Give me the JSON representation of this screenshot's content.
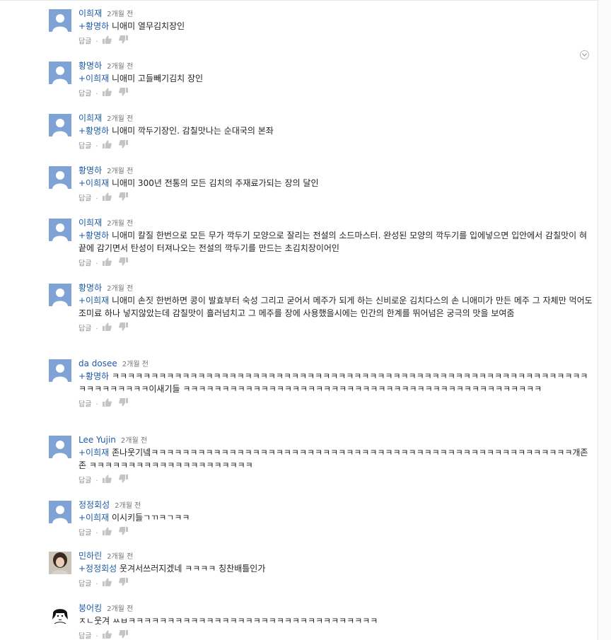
{
  "ui": {
    "reply_label": "답글",
    "separator": "·",
    "accent_link": "#1f5ba8",
    "menu_icon": "chevron-down-circle-icon"
  },
  "comments": [
    {
      "author": "이희재",
      "time": "2개월 전",
      "mention": "+황명하",
      "text": " 니애미 열무김치장인",
      "avatar": "default"
    },
    {
      "author": "황명하",
      "time": "2개월 전",
      "mention": "+이희재",
      "text": " 니애미 고들빼기김치 장인",
      "avatar": "default"
    },
    {
      "author": "이희재",
      "time": "2개월 전",
      "mention": "+황명하",
      "text": " 니애미 깍두기장인. 감칠맛나는 순대국의 본좌",
      "avatar": "default"
    },
    {
      "author": "황명하",
      "time": "2개월 전",
      "mention": "+이희재",
      "text": " 니애미 300년 전통의 모든 김치의 주재료가되는 장의 달인",
      "avatar": "default"
    },
    {
      "author": "이희재",
      "time": "2개월 전",
      "mention": "+황명하",
      "text": " 니애미 칼질 한번으로 모든 무가 깍두기 모양으로 잘리는 전설의 소드마스터. 완성된 모양의 깍두기를 입에넣으면 입안에서 감칠맛이 혀끝에 감기면서 탄성이 터져나오는 전설의 깍두기를 만드는 초김치장이어인",
      "avatar": "default"
    },
    {
      "author": "황명하",
      "time": "2개월 전",
      "mention": "+이희재",
      "text": " 니애미 손짓 한번하면 콩이 발효부터 숙성 그리고 굳어서 메주가 되게 하는 신비로운 김치다스의 손 니애미가 만든 메주 그 자체만 먹어도 조미료 하나 넣지않았는데 감칠맛이 흘러넘치고 그 메주를 장에 사용했을시에는 인간의 한계를 뛰어넘은 궁극의 맛을 보여줌",
      "avatar": "default"
    },
    {
      "author": "da dosee",
      "time": "2개월 전",
      "mention": "+황명하",
      "text": " ㅋㅋㅋㅋㅋㅋㅋㅋㅋㅋㅋㅋㅋㅋㅋㅋㅋㅋㅋㅋㅋㅋㅋㅋㅋㅋㅋㅋㅋㅋㅋㅋㅋㅋㅋㅋㅋㅋㅋㅋㅋㅋㅋㅋㅋㅋㅋㅋㅋㅋㅋㅋㅋㅋㅋㅋㅋㅋㅋㅋㅋㅋㅋㅋㅋㅋㅋㅋㅋㅋ이새기들 ㅋㅋㅋㅋㅋㅋㅋㅋㅋㅋㅋㅋㅋㅋㅋㅋㅋㅋㅋㅋㅋㅋㅋㅋㅋㅋㅋㅋㅋㅋㅋㅋㅋㅋㅋㅋㅋㅋㅋㅋㅋㅋㅋㅋㅋㅋ",
      "avatar": "default"
    },
    {
      "author": "Lee Yujin",
      "time": "2개월 전",
      "mention": "+이희재",
      "text": " 존나웃기넼ㅋㅋㅋㅋㅋㅋㅋㅋㅋㅋㅋㅋㅋㅋㅋㅋㅋㅋㅋㅋㅋㅋㅋㅋㅋㅋㅋㅋㅋㅋㅋㅋㅋㅋㅋㅋㅋㅋㅋㅋㅋㅋㅋㅋㅋㅋㅋㅋㅋㅋㅋㅋㅋㅋ개존존 ㅋㅋㅋㅋㅋㅋㅋㅋㅋㅋㅋㅋㅋㅋㅋㅋㅋㅋㅋㅋㅋ",
      "avatar": "default"
    },
    {
      "author": "정정회성",
      "time": "2개월 전",
      "mention": "+이희재",
      "text": " 이시키들ㄱㄲㅋㄱㅋㅋ",
      "avatar": "default"
    },
    {
      "author": "민하린",
      "time": "2개월 전",
      "mention": "+정정회성",
      "text": " 웃겨서쓰러지겠네 ㅋㅋㅋㅋ 칭찬배틀인가",
      "avatar": "photo"
    },
    {
      "author": "붕어킹",
      "time": "2개월 전",
      "mention": "",
      "text": "ㅈㄴ웃겨 ㅆㅂㅋㅋㅋㅋㅋㅋㅋㅋㅋㅋㅋㅋㅋㅋㅋㅋㅋㅋㅋㅋㅋㅋㅋㅋㅋㅋㅋㅋㅋㅋㅋㅋ",
      "avatar": "drawing"
    }
  ]
}
